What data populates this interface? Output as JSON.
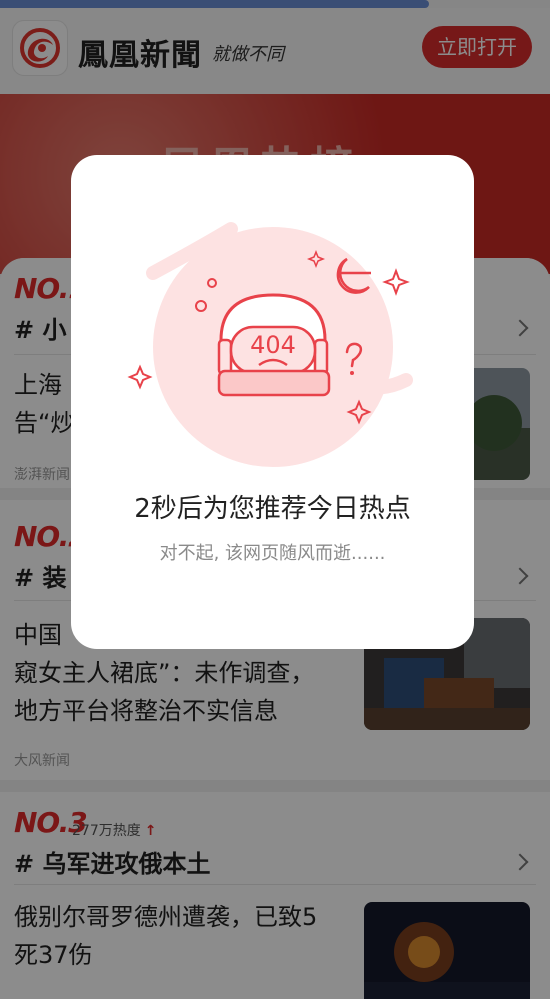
{
  "loading_progress": 0.78,
  "header": {
    "brand": "鳳凰新聞",
    "slogan": "就做不同",
    "open_button": "立即打开"
  },
  "banner": {
    "title": "凤凰热榜"
  },
  "news": [
    {
      "rank": "NO.1",
      "topic": "# 小",
      "headline": "上海\n告“炒",
      "source": "澎湃新闻"
    },
    {
      "rank": "NO.2",
      "topic": "# 装",
      "headline": "中国\n窥女主人裙底”：未作调查，\n地方平台将整治不实信息",
      "source": "大风新闻"
    },
    {
      "rank": "NO.3",
      "heat": "277万热度",
      "topic": "# 乌军进攻俄本土",
      "headline": "俄别尔哥罗德州遭袭，已致5\n死37伤"
    }
  ],
  "modal": {
    "error_code": "404",
    "title": "2秒后为您推荐今日热点",
    "subtitle": "对不起, 该网页随风而逝......"
  },
  "colors": {
    "brand_red": "#d72c2c",
    "rank_red": "#e02a2a",
    "illustration_red": "#e8424a",
    "illustration_pink": "#fde2e2"
  }
}
